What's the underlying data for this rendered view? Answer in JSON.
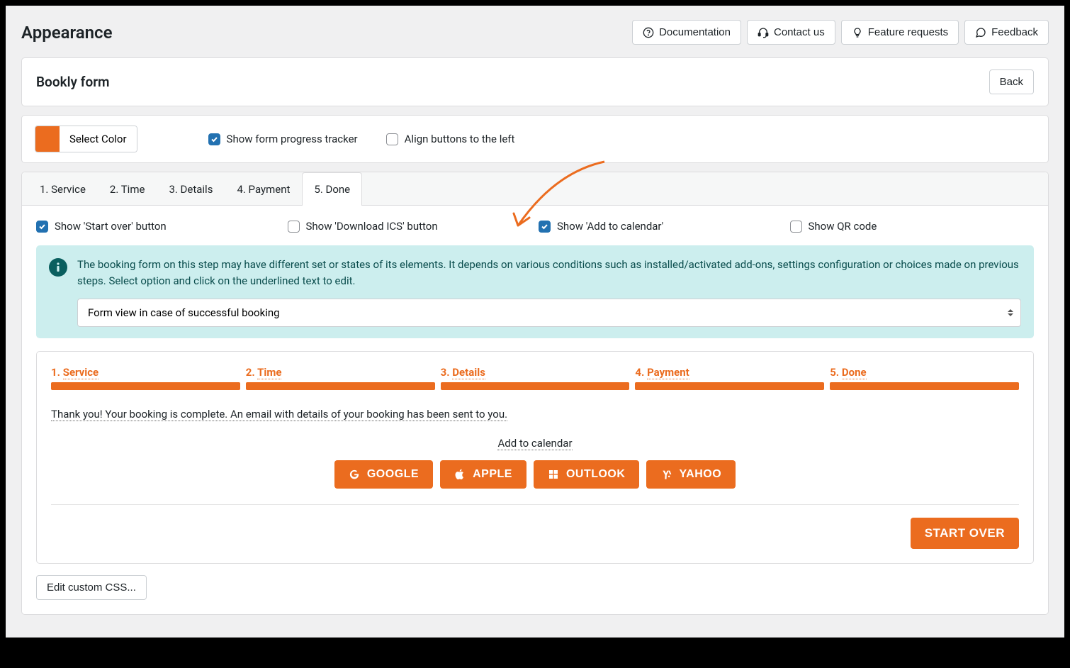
{
  "page": {
    "title": "Appearance"
  },
  "header_buttons": {
    "documentation": "Documentation",
    "contact": "Contact us",
    "feature_requests": "Feature requests",
    "feedback": "Feedback"
  },
  "panel": {
    "title": "Bookly form",
    "back": "Back"
  },
  "options": {
    "select_color": "Select Color",
    "color": "#eb6c1f",
    "show_progress": "Show form progress tracker",
    "align_left": "Align buttons to the left"
  },
  "tabs": [
    {
      "label": "1. Service"
    },
    {
      "label": "2. Time"
    },
    {
      "label": "3. Details"
    },
    {
      "label": "4. Payment"
    },
    {
      "label": "5. Done",
      "active": true
    }
  ],
  "done_checks": {
    "start_over": "Show 'Start over' button",
    "download_ics": "Show 'Download ICS' button",
    "add_to_cal": "Show 'Add to calendar'",
    "qr": "Show QR code"
  },
  "info": {
    "text": "The booking form on this step may have different set or states of its elements. It depends on various conditions such as installed/activated add-ons, settings configuration or choices made on previous steps. Select option and click on the underlined text to edit.",
    "select_value": "Form view in case of successful booking"
  },
  "preview": {
    "steps": [
      {
        "num": "1.",
        "label": "Service"
      },
      {
        "num": "2.",
        "label": "Time"
      },
      {
        "num": "3.",
        "label": "Details"
      },
      {
        "num": "4.",
        "label": "Payment"
      },
      {
        "num": "5.",
        "label": "Done"
      }
    ],
    "thank_you": "Thank you! Your booking is complete. An email with details of your booking has been sent to you.",
    "add_to_calendar": "Add to calendar",
    "cal_buttons": {
      "google": "GOOGLE",
      "apple": "APPLE",
      "outlook": "OUTLOOK",
      "yahoo": "YAHOO"
    },
    "start_over": "START OVER"
  },
  "edit_css": "Edit custom CSS..."
}
